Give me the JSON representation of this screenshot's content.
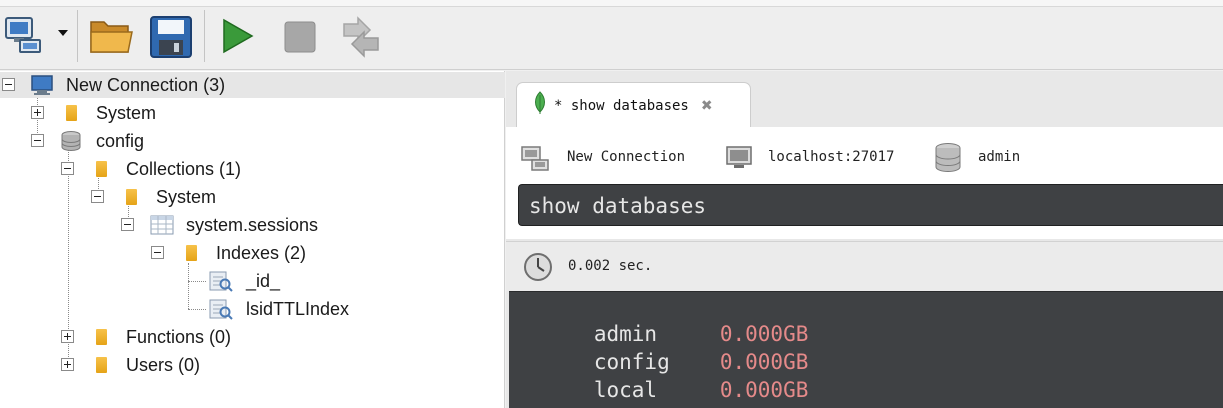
{
  "tree": {
    "connection_label": "New Connection (3)",
    "system_label": "System",
    "config_label": "config",
    "collections_label": "Collections (1)",
    "config_system_label": "System",
    "sessions_label": "system.sessions",
    "indexes_label": "Indexes (2)",
    "index1_label": "_id_",
    "index2_label": "lsidTTLIndex",
    "functions_label": "Functions (0)",
    "users_label": "Users (0)"
  },
  "tab": {
    "label": "* show databases",
    "close_icon": "✖"
  },
  "info": {
    "connection": "New Connection",
    "server": "localhost:27017",
    "database": "admin"
  },
  "query": {
    "text": "show databases"
  },
  "status": {
    "time": "0.002 sec."
  },
  "results": {
    "rows": [
      {
        "name": "admin",
        "size": "0.000GB"
      },
      {
        "name": "config",
        "size": "0.000GB"
      },
      {
        "name": "local",
        "size": "0.000GB"
      }
    ]
  },
  "colors": {
    "result_size": "#e58a8a",
    "query_bg": "#3f4144",
    "run_green": "#3a9a3a"
  }
}
